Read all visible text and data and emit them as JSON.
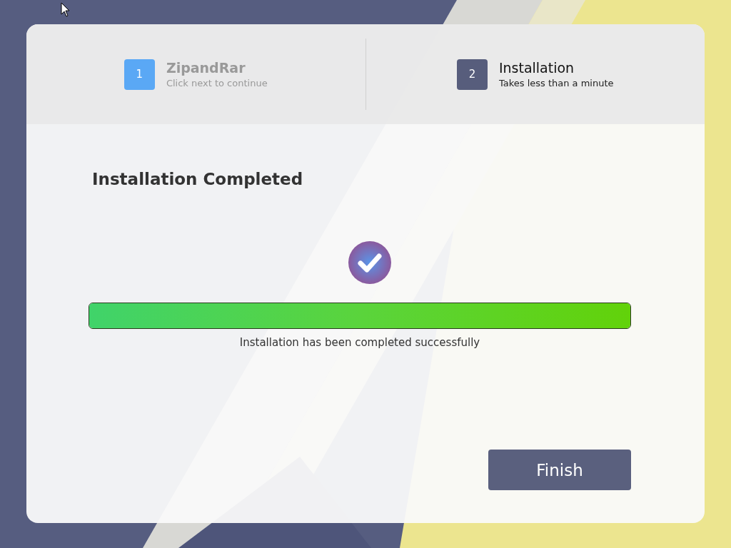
{
  "steps": [
    {
      "number": "1",
      "title": "ZipandRar",
      "subtitle": "Click next to continue",
      "selected": false
    },
    {
      "number": "2",
      "title": "Installation",
      "subtitle": "Takes less than a minute",
      "selected": true
    }
  ],
  "heading": "Installation Completed",
  "progress": {
    "level": 1,
    "message": "Installation has been completed successfully"
  },
  "finish_button": "Finish"
}
